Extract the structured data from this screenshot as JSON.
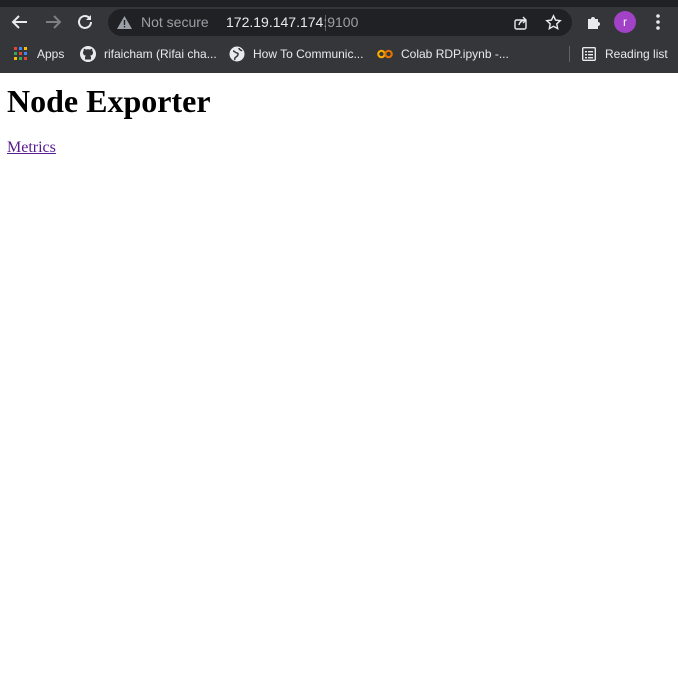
{
  "browser": {
    "security_label": "Not secure",
    "url_host": "172.19.147.174",
    "url_port": ":9100",
    "profile_initial": "r",
    "bookmarks": [
      {
        "label": "Apps"
      },
      {
        "label": "rifaicham (Rifai cha..."
      },
      {
        "label": "How To Communic..."
      },
      {
        "label": "Colab RDP.ipynb -..."
      }
    ],
    "reading_list_label": "Reading list"
  },
  "page": {
    "title": "Node Exporter",
    "link_label": "Metrics"
  },
  "colors": {
    "chrome_bg": "#35363a",
    "omnibox_bg": "#202124",
    "avatar": "#a142c7",
    "visited_link": "#551a8b"
  }
}
